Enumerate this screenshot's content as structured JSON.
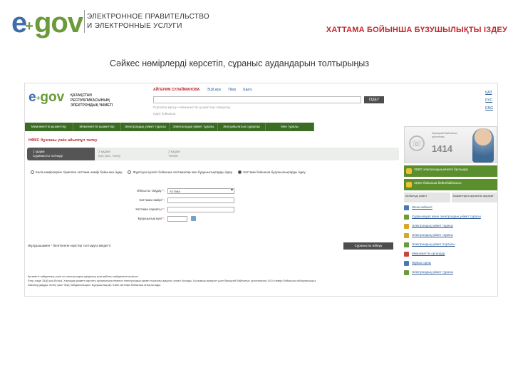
{
  "header": {
    "logo_e": "e",
    "logo_plus": "+",
    "logo_gov": "gov",
    "org_line1": "ЭЛЕКТРОННОЕ ПРАВИТЕЛЬСТВО",
    "org_line2": "И ЭЛЕКТРОННЫЕ УСЛУГИ",
    "title": "ХАТТАМА БОЙЫНША БҮЗУШЫЛЫҚТЫ ІЗДЕУ",
    "subtitle": "Сәйкес нөмірлерді көрсетіп, сұраныс аудандарын толтырыңыз"
  },
  "colors": {
    "accent_red": "#c0282d",
    "brand_green": "#6a9a3a",
    "brand_blue": "#3e6ea9",
    "nav_green": "#3b6c24"
  },
  "portal": {
    "logo_e": "e",
    "logo_plus": "+",
    "logo_gov": "gov",
    "org": "ҚАЗАҚСТАН РЕСПУБЛИКАСЫНЫҢ ЭЛЕКТРОНДЫҚ ҮКІМЕТІ",
    "user": "АЙГЕРИМ СУЛАЙМАНОВА",
    "top_links": [
      "ЭЦҚ кіру",
      "Пікір",
      "Шығу"
    ],
    "search_button": "ІЗДЕУ",
    "search_hint": "Порталға кіргізу • Мемлекеттік қызметтер • Бақылау",
    "search_hint2": "Іздеу бойынша",
    "langs": [
      "ҚАЗ",
      "РУС",
      "ENG"
    ],
    "nav": [
      "Мемлекеттік қызметтер",
      "Мемлекеттік қызметтер",
      "Электрондық үкімет туралы",
      "Электрондық үкімет туралы",
      "Жиі қойылатын сұрақтар",
      "Мен туралы"
    ],
    "main_title": "НӨКС бұзғаны үшін айыппұл төлеу",
    "steps": [
      {
        "title": "1 қадам",
        "desc": "Сұранысты толтыру"
      },
      {
        "title": "2 қадам",
        "desc": "Қол қою, төлеу"
      },
      {
        "title": "3 қадам",
        "desc": "Төлем"
      }
    ],
    "radios": [
      {
        "label": "Көлік нөмірлеріне тіркелген хаттама нөмірі бойынша іздеу",
        "selected": false
      },
      {
        "label": "Жүргізуші куәлігі бойынша хаттамалар мен бұзушылықтарды іздеу",
        "selected": false
      },
      {
        "label": "Хаттама бойынша бұзушылықтарды іздеу",
        "selected": true
      }
    ],
    "form": [
      {
        "label": "Облысты таңдау",
        "value": "Астана"
      },
      {
        "label": "Хаттама нөмірі",
        "value": ""
      },
      {
        "label": "Хаттама сериясы",
        "value": ""
      },
      {
        "label": "Бұзушылық күні",
        "value": ""
      }
    ],
    "required_mark": "*",
    "note_prefix": "Жұлдызшамен",
    "note_text": "белгіленген өрістер толтыруға міндетті",
    "submit": "Сұранысты жіберу",
    "footer": [
      "Қызметті пайдалану үшін сіз электрондық цифрлық қолтаңбаны пайдалана аласыз.",
      "Егер сізде ЭЦҚ жоқ болса, Халыққа қызмет көрсету орталығына немесе электрондық үкімет порталы арқылы алуға болады. Қосымша ақпарат үшін бірыңғай байланыс орталығына 1414 нөмірі бойынша хабарласыңыз.",
      "Айыппұлдарды төлеу үшін ЭЦҚ пайдаланыңыз. Бұзушылықтар тізімі хаттама бойынша анықталады."
    ],
    "call_text": "Бірыңғай байланыс орталығы",
    "call_number": "1414",
    "side_green1": "ХҚКО электрондық кезекті броньдау",
    "side_green2": "ХҚКО бойынша бейнебайланыс",
    "side_gray": [
      "Мобильді үкімет",
      "Азаматтарға арналған ақпарат"
    ],
    "side_links": [
      "Жеке кабинет",
      "Сұрақ-жауап және электрондық үкімет туралы",
      "Электрондық үкімет тарихы",
      "Электрондық үкімет тарихы",
      "Электрондық үкімет порталы",
      "Мемлекеттік органдар",
      "Жұмыс орны",
      "Электрондық үкімет туралы"
    ]
  }
}
